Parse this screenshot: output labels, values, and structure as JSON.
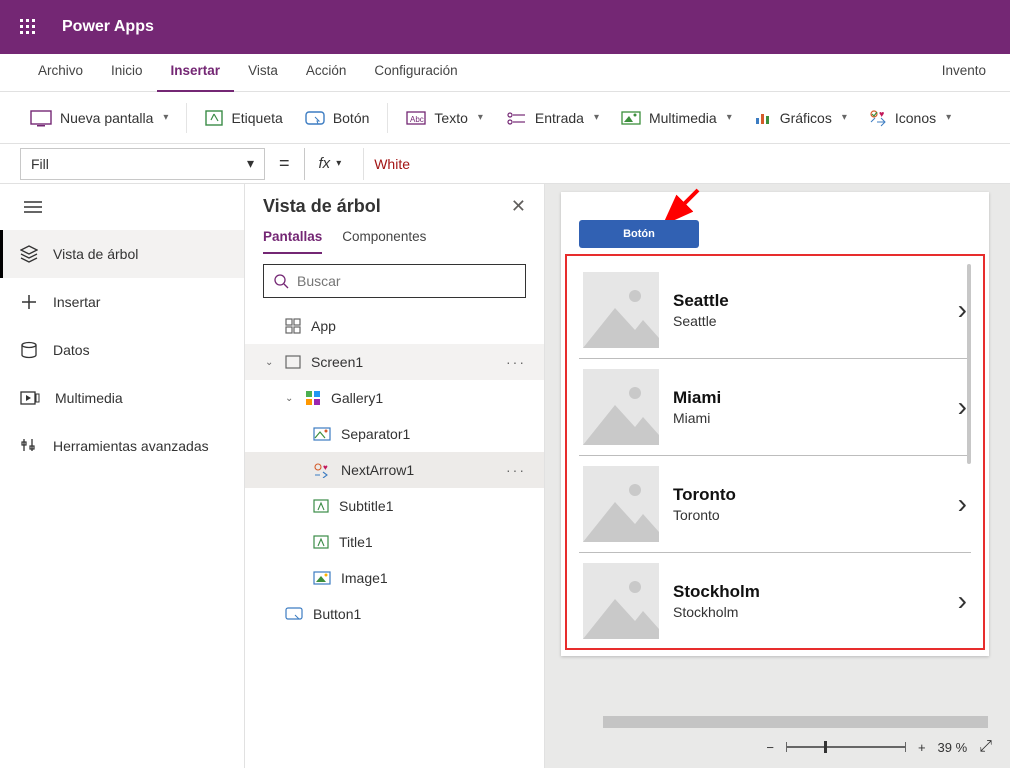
{
  "app": {
    "title": "Power Apps"
  },
  "menus": {
    "file": "Archivo",
    "home": "Inicio",
    "insert": "Insertar",
    "view": "Vista",
    "action": "Acción",
    "config": "Configuración",
    "right": "Invento"
  },
  "ribbon": {
    "new_screen": "Nueva pantalla",
    "label": "Etiqueta",
    "button": "Botón",
    "text": "Texto",
    "input": "Entrada",
    "media": "Multimedia",
    "charts": "Gráficos",
    "icons": "Iconos"
  },
  "formula": {
    "property": "Fill",
    "fx": "fx",
    "value": "White"
  },
  "leftnav": {
    "tree": "Vista de árbol",
    "insert": "Insertar",
    "data": "Datos",
    "media": "Multimedia",
    "advanced": "Herramientas avanzadas"
  },
  "tree": {
    "title": "Vista de árbol",
    "tabs": {
      "screens": "Pantallas",
      "components": "Componentes"
    },
    "search_placeholder": "Buscar",
    "app": "App",
    "screen1": "Screen1",
    "gallery1": "Gallery1",
    "separator1": "Separator1",
    "nextarrow1": "NextArrow1",
    "subtitle1": "Subtitle1",
    "title1": "Title1",
    "image1": "Image1",
    "button1": "Button1"
  },
  "canvas": {
    "button_label": "Botón",
    "items": [
      {
        "title": "Seattle",
        "subtitle": "Seattle"
      },
      {
        "title": "Miami",
        "subtitle": "Miami"
      },
      {
        "title": "Toronto",
        "subtitle": "Toronto"
      },
      {
        "title": "Stockholm",
        "subtitle": "Stockholm"
      }
    ]
  },
  "zoom": {
    "value": "39",
    "suffix": " %"
  }
}
